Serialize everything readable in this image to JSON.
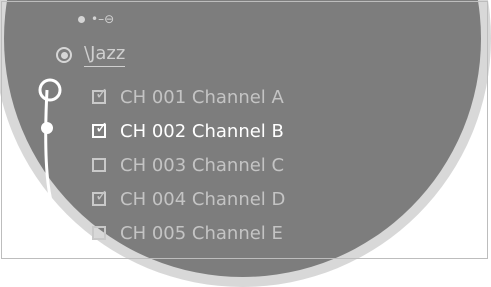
{
  "folder": {
    "icon": "radio-selected-icon",
    "label": "\\Jazz"
  },
  "top_strip": {
    "icon": "connection-key-icon",
    "text": "•–⊖"
  },
  "channels": [
    {
      "label": "CH 001 Channel A",
      "checked": true,
      "active": false
    },
    {
      "label": "CH 002 Channel B",
      "checked": true,
      "active": true
    },
    {
      "label": "CH 003 Channel C",
      "checked": false,
      "active": false
    },
    {
      "label": "CH 004 Channel D",
      "checked": true,
      "active": false
    },
    {
      "label": "CH 005 Channel E",
      "checked": false,
      "active": false
    }
  ],
  "colors": {
    "screen": "#7d7d7d",
    "text": "#c4c4c4",
    "active_text": "#ffffff",
    "rim": "#d8d8d8"
  }
}
